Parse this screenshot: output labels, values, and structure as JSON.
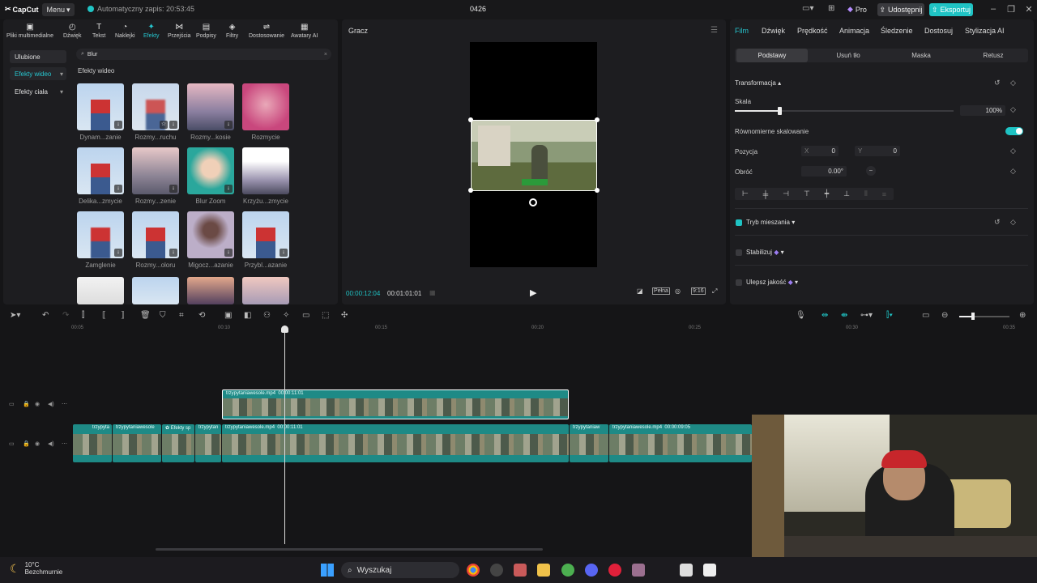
{
  "app": {
    "logo_text": "CapCut",
    "menu_label": "Menu",
    "autosave_text": "Automatyczny zapis: 20:53:45",
    "project_title": "0426",
    "pro_label": "Pro",
    "share_label": "Udostępnij",
    "export_label": "Eksportuj",
    "accent_color": "#1fc3c4"
  },
  "toolbar": {
    "tabs": [
      {
        "label": "Pliki multimedialne",
        "icon": "media-icon"
      },
      {
        "label": "Dźwięk",
        "icon": "audio-icon"
      },
      {
        "label": "Tekst",
        "icon": "text-icon"
      },
      {
        "label": "Naklejki",
        "icon": "sticker-icon"
      },
      {
        "label": "Efekty",
        "icon": "effects-icon",
        "active": true
      },
      {
        "label": "Przejścia",
        "icon": "transitions-icon"
      },
      {
        "label": "Podpisy",
        "icon": "captions-icon"
      },
      {
        "label": "Filtry",
        "icon": "filters-icon"
      },
      {
        "label": "Dostosowanie",
        "icon": "adjust-icon"
      },
      {
        "label": "Awatary AI",
        "icon": "avatar-icon"
      }
    ]
  },
  "sidebar": {
    "items": [
      {
        "label": "Ulubione"
      },
      {
        "label": "Efekty wideo",
        "active": true
      },
      {
        "label": "Efekty ciała"
      }
    ]
  },
  "search": {
    "value": "Blur"
  },
  "effects": {
    "section_title": "Efekty wideo",
    "items": [
      {
        "label": "Dynam...zanie"
      },
      {
        "label": "Rozmy...ruchu"
      },
      {
        "label": "Rozmy...kosie"
      },
      {
        "label": "Rozmycie"
      },
      {
        "label": "Delika...zmycie"
      },
      {
        "label": "Rozmy...zenie"
      },
      {
        "label": "Blur Zoom"
      },
      {
        "label": "Krzyżu...zmycie"
      },
      {
        "label": "Zamglenie"
      },
      {
        "label": "Rozmy...oloru"
      },
      {
        "label": "Migocz...azanie"
      },
      {
        "label": "Przybl...azanie"
      }
    ]
  },
  "player": {
    "title": "Gracz",
    "current_time": "00:00:12:04",
    "total_time": "00:01:01:01",
    "quality_label": "Pełna",
    "ratio_label": "9:16"
  },
  "props": {
    "tabs": [
      "Film",
      "Dźwięk",
      "Prędkość",
      "Animacja",
      "Śledzenie",
      "Dostosuj",
      "Stylizacja AI"
    ],
    "subtabs": [
      "Podstawy",
      "Usuń tło",
      "Maska",
      "Retusz"
    ],
    "transform_label": "Transformacja",
    "scale_label": "Skala",
    "scale_value": "100%",
    "uniform_label": "Równomierne skalowanie",
    "position_label": "Pozycja",
    "x_label": "X",
    "x_value": "0",
    "y_label": "Y",
    "y_value": "0",
    "rotate_label": "Obróć",
    "rotate_value": "0.00°",
    "blend_label": "Tryb mieszania",
    "stabilize_label": "Stabilizuj",
    "enhance_label": "Ulepsz jakość"
  },
  "timeline": {
    "ticks": [
      "00:05",
      "00:10",
      "00:15",
      "00:20",
      "00:25",
      "00:30",
      "00:35"
    ],
    "overlay_clip": {
      "name": "trzypytaniawesole.mp4",
      "duration": "00:00:11:01"
    },
    "main_clips": [
      {
        "name": "trzypyta"
      },
      {
        "name": "trzypytaniawesole"
      },
      {
        "name": "Efekty sp"
      },
      {
        "name": "trzypytan"
      },
      {
        "name": "trzypytaniawesole.mp4",
        "duration": "00:00:11:01"
      },
      {
        "name": "trzypytaniaw"
      },
      {
        "name": "trzypytaniawesole.mp4",
        "duration": "00:00:09:05"
      }
    ]
  },
  "taskbar": {
    "temp": "10°C",
    "weather": "Bezchmurnie",
    "search_placeholder": "Wyszukaj"
  }
}
